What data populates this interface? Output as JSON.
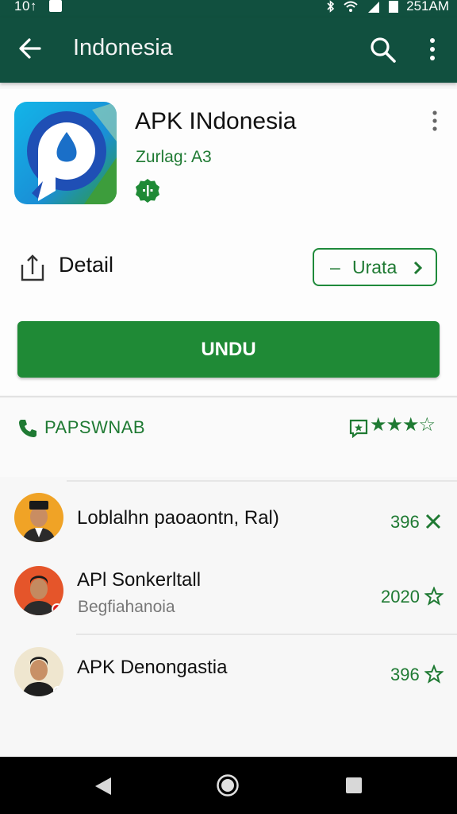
{
  "status_bar": {
    "time": "10↑",
    "clock": "251AM"
  },
  "app_bar": {
    "title": "Indonesia"
  },
  "app": {
    "name": "APK INdonesia",
    "subtitle": "Zurlag: A3",
    "detail_label": "Detail",
    "secondary_button": {
      "prefix": "–",
      "label": "Urata"
    },
    "install_label": "UNDU"
  },
  "contact": {
    "label": "PAPSWNAB",
    "stars": "★★★☆"
  },
  "list": [
    {
      "title": "Loblalhn paoaontn, Ral)",
      "subtitle": "",
      "score": "396",
      "icon": "x-icon"
    },
    {
      "title": "APl Sonkerltall",
      "subtitle": "Begfiahanoia",
      "score": "2020",
      "icon": "star-outline-icon"
    },
    {
      "title": "APK Denongastia",
      "subtitle": "",
      "score": "396",
      "icon": "star-outline-icon"
    }
  ],
  "colors": {
    "header": "#11503f",
    "accent": "#1f8a36",
    "accent_text": "#1f7a33"
  }
}
